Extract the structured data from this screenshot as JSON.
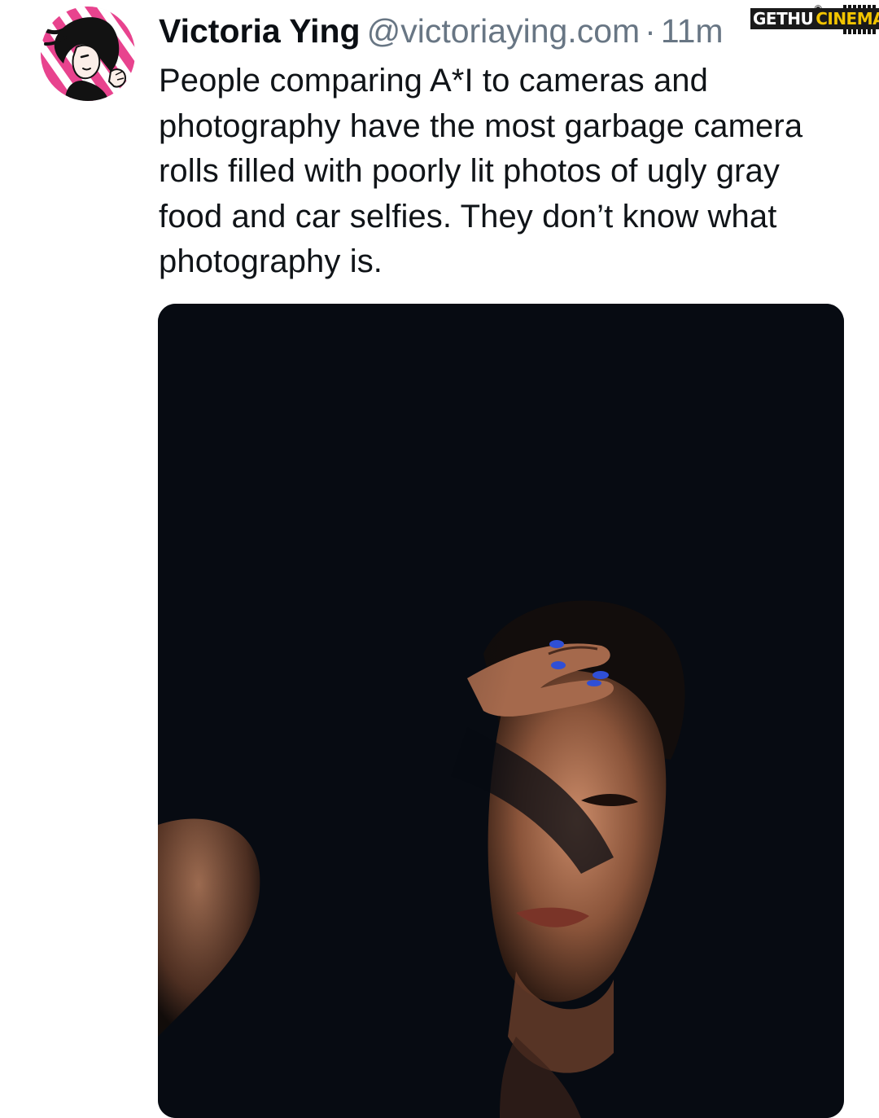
{
  "post": {
    "author": {
      "display_name": "Victoria Ying",
      "handle": "@victoriaying.com",
      "separator": "·",
      "time": "11m"
    },
    "text": "People comparing A*I to cameras and photography have the most garbage camera rolls filled with poorly lit photos of ugly gray food and car selfies. They don’t know what photography is.",
    "media": {
      "type": "photo",
      "subject": "portrait"
    }
  },
  "watermark": {
    "part1": "GETHU",
    "part2": "CINEMA",
    "icon": "camera-icon"
  },
  "colors": {
    "text": "#101418",
    "muted": "#687684",
    "background": "#ffffff",
    "photo_bg": "#070b12",
    "avatar_accent": "#e8438e",
    "nail_polish": "#2f4fd6",
    "watermark_yellow": "#f2c400"
  }
}
